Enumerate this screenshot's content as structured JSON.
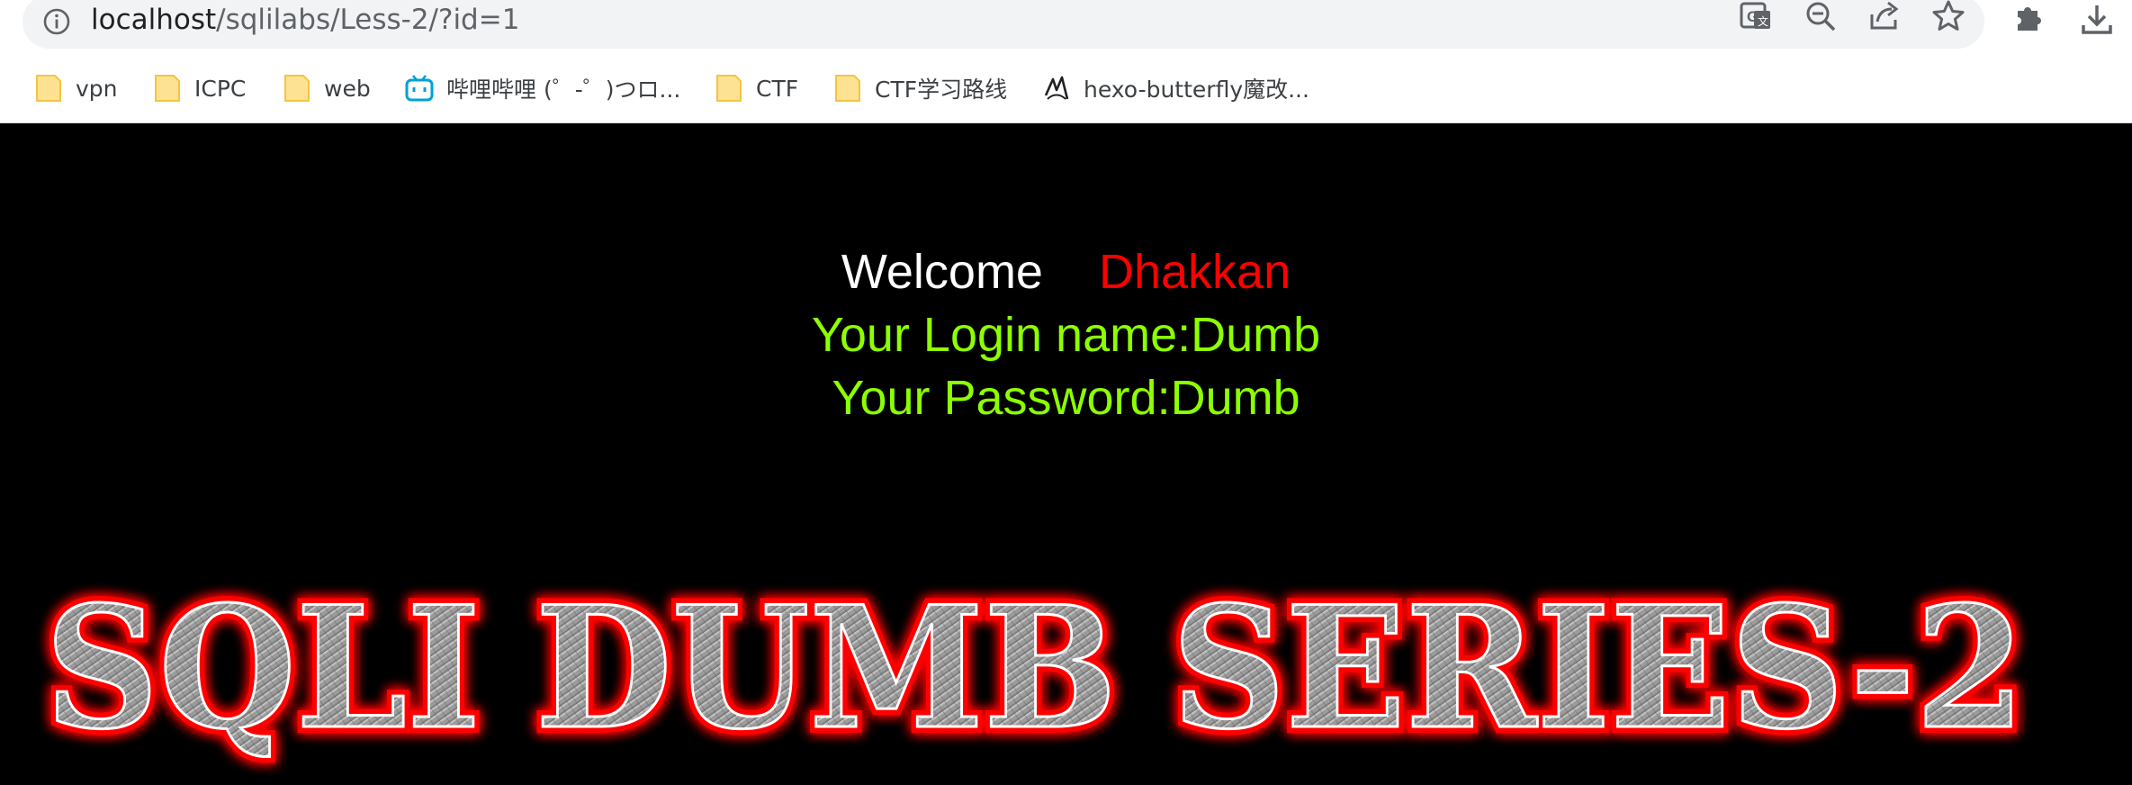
{
  "address_bar": {
    "host": "localhost",
    "path": "/sqlilabs/Less-2/?id=1"
  },
  "toolbar_icons": [
    "translate-icon",
    "zoom-out-icon",
    "share-icon",
    "star-icon",
    "extensions-icon",
    "download-icon"
  ],
  "bookmarks": [
    {
      "label": "vpn",
      "icon": "folder-icon"
    },
    {
      "label": "ICPC",
      "icon": "folder-icon"
    },
    {
      "label": "web",
      "icon": "folder-icon"
    },
    {
      "label": "哔哩哔哩 (゜-゜)つロ...",
      "icon": "bilibili-icon"
    },
    {
      "label": "CTF",
      "icon": "folder-icon"
    },
    {
      "label": "CTF学习路线",
      "icon": "folder-icon"
    },
    {
      "label": "hexo-butterfly魔改...",
      "icon": "site-logo-icon"
    }
  ],
  "page": {
    "welcome": "Welcome",
    "user_alias": "Dhakkan",
    "login_line": "Your Login name:Dumb",
    "password_line": "Your Password:Dumb",
    "banner_text": "SQLI DUMB SERIES-2"
  },
  "colors": {
    "page_bg": "#000000",
    "welcome": "#ffffff",
    "alias": "#ff0000",
    "credentials": "#8cff00",
    "banner_glow": "#ff0000",
    "banner_fill": "#9a9a9a"
  }
}
